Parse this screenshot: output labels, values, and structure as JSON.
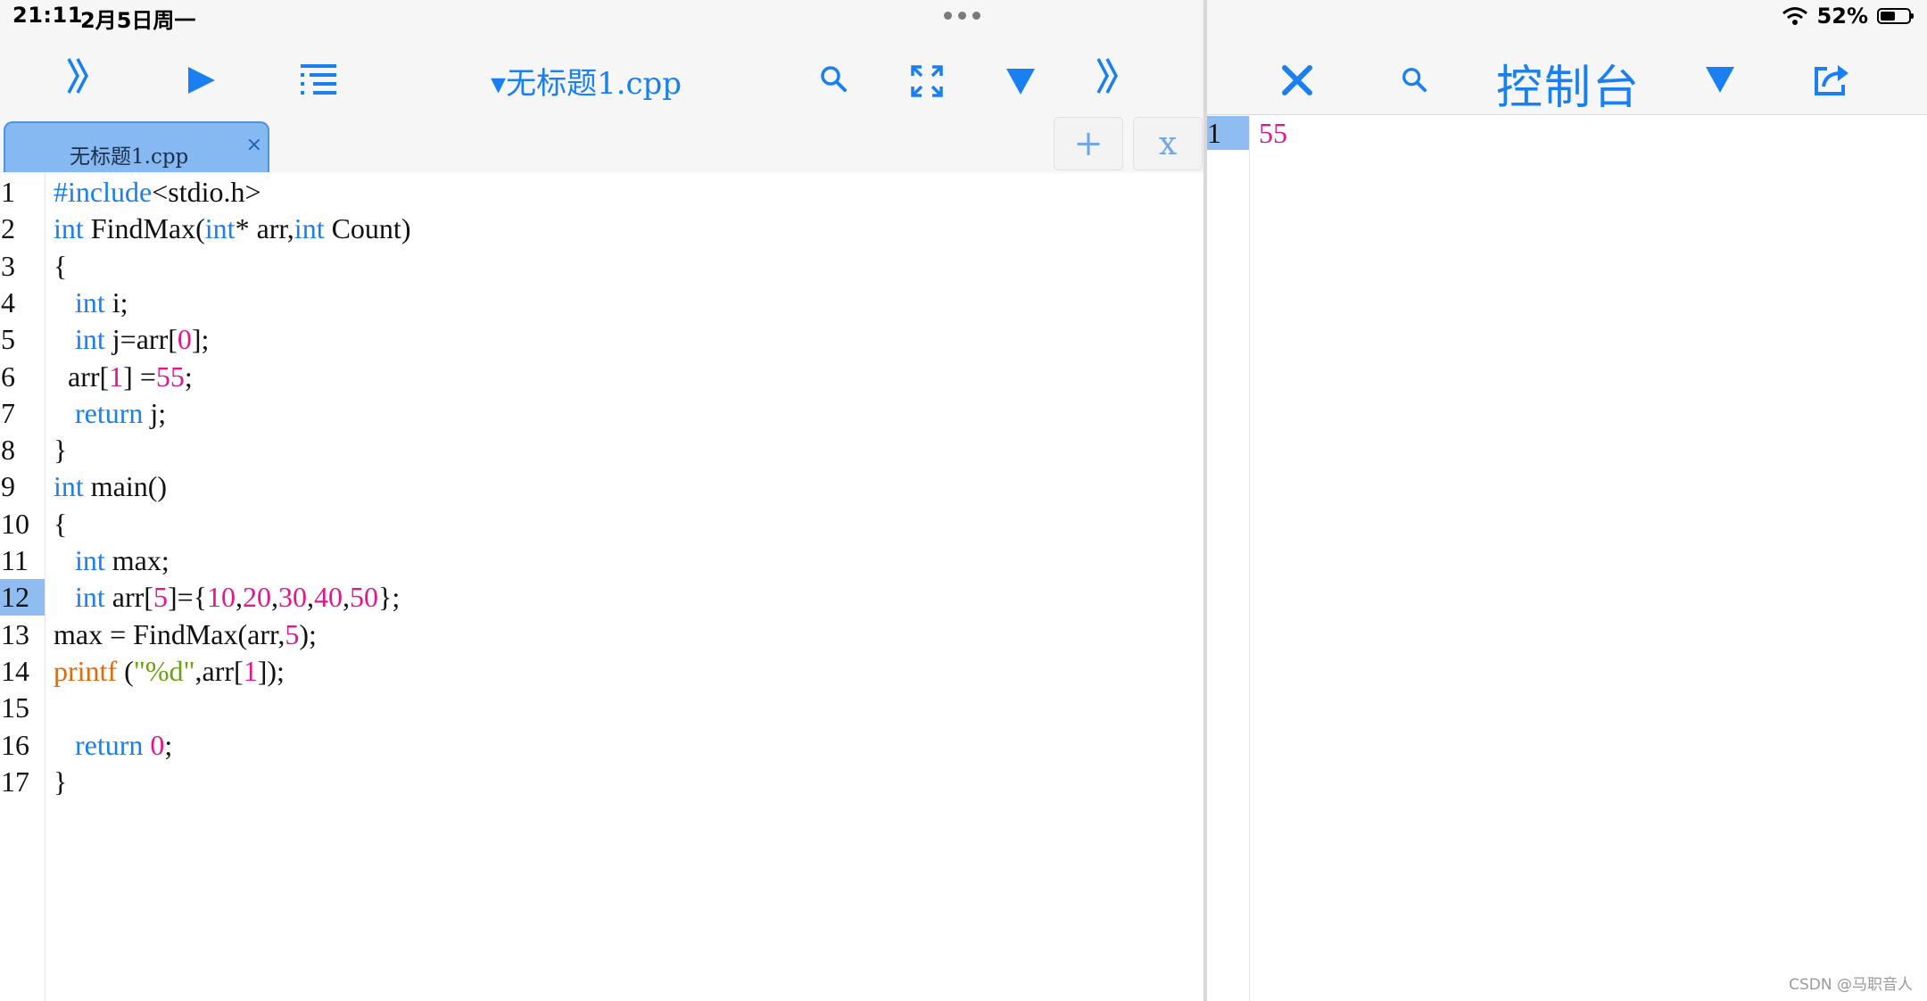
{
  "status_bar": {
    "time": "21:11",
    "date": "2月5日周一",
    "battery_percent": "52%",
    "battery_level": 0.52
  },
  "editor": {
    "toolbar": {
      "file_title": "▾无标题1.cpp",
      "icons": [
        "double-chevron-right-icon",
        "play-icon",
        "outline-list-icon",
        "search-icon",
        "expand-icon",
        "triangle-down-icon",
        "double-chevron-right-icon"
      ]
    },
    "tab": {
      "label": "无标题1.cpp",
      "close": "×"
    },
    "tab_buttons": {
      "add": "+",
      "close": "x"
    },
    "active_line": 12,
    "line_numbers": [
      "1",
      "2",
      "3",
      "4",
      "5",
      "6",
      "7",
      "8",
      "9",
      "10",
      "11",
      "12",
      "13",
      "14",
      "15",
      "16",
      "17"
    ],
    "code": [
      [
        {
          "t": "#include",
          "c": "pp"
        },
        {
          "t": "<stdio.h>",
          "c": ""
        }
      ],
      [
        {
          "t": "int",
          "c": "kw"
        },
        {
          "t": " FindMax(",
          "c": ""
        },
        {
          "t": "int",
          "c": "kw"
        },
        {
          "t": "* arr,",
          "c": ""
        },
        {
          "t": "int",
          "c": "kw"
        },
        {
          "t": " Count)",
          "c": ""
        }
      ],
      [
        {
          "t": "{",
          "c": ""
        }
      ],
      [
        {
          "t": "   ",
          "c": ""
        },
        {
          "t": "int",
          "c": "kw"
        },
        {
          "t": " i;",
          "c": ""
        }
      ],
      [
        {
          "t": "   ",
          "c": ""
        },
        {
          "t": "int",
          "c": "kw"
        },
        {
          "t": " j=arr[",
          "c": ""
        },
        {
          "t": "0",
          "c": "num"
        },
        {
          "t": "];",
          "c": ""
        }
      ],
      [
        {
          "t": "  arr[",
          "c": ""
        },
        {
          "t": "1",
          "c": "num"
        },
        {
          "t": "] =",
          "c": ""
        },
        {
          "t": "55",
          "c": "num"
        },
        {
          "t": ";",
          "c": ""
        }
      ],
      [
        {
          "t": "   ",
          "c": ""
        },
        {
          "t": "return",
          "c": "kw"
        },
        {
          "t": " j;",
          "c": ""
        }
      ],
      [
        {
          "t": "}",
          "c": ""
        }
      ],
      [
        {
          "t": "int",
          "c": "kw"
        },
        {
          "t": " main()",
          "c": ""
        }
      ],
      [
        {
          "t": "{",
          "c": ""
        }
      ],
      [
        {
          "t": "   ",
          "c": ""
        },
        {
          "t": "int",
          "c": "kw"
        },
        {
          "t": " max;",
          "c": ""
        }
      ],
      [
        {
          "t": "   ",
          "c": ""
        },
        {
          "t": "int",
          "c": "kw"
        },
        {
          "t": " arr[",
          "c": ""
        },
        {
          "t": "5",
          "c": "num"
        },
        {
          "t": "]={",
          "c": ""
        },
        {
          "t": "10",
          "c": "num"
        },
        {
          "t": ",",
          "c": ""
        },
        {
          "t": "20",
          "c": "num"
        },
        {
          "t": ",",
          "c": ""
        },
        {
          "t": "30",
          "c": "num"
        },
        {
          "t": ",",
          "c": ""
        },
        {
          "t": "40",
          "c": "num"
        },
        {
          "t": ",",
          "c": ""
        },
        {
          "t": "50",
          "c": "num"
        },
        {
          "t": "};",
          "c": ""
        }
      ],
      [
        {
          "t": "max = FindMax(arr,",
          "c": ""
        },
        {
          "t": "5",
          "c": "num"
        },
        {
          "t": ");",
          "c": ""
        }
      ],
      [
        {
          "t": "printf",
          "c": "fn"
        },
        {
          "t": " (",
          "c": ""
        },
        {
          "t": "\"%d\"",
          "c": "str"
        },
        {
          "t": ",arr[",
          "c": ""
        },
        {
          "t": "1",
          "c": "num"
        },
        {
          "t": "]);",
          "c": ""
        }
      ],
      [
        {
          "t": "",
          "c": ""
        }
      ],
      [
        {
          "t": "   ",
          "c": ""
        },
        {
          "t": "return",
          "c": "kw"
        },
        {
          "t": " ",
          "c": ""
        },
        {
          "t": "0",
          "c": "num"
        },
        {
          "t": ";",
          "c": ""
        }
      ],
      [
        {
          "t": "}",
          "c": ""
        }
      ]
    ]
  },
  "console": {
    "title": "控制台",
    "icons": [
      "close-icon",
      "search-icon",
      "triangle-down-icon",
      "share-icon"
    ],
    "output_lines": [
      {
        "num": "1",
        "text": "55"
      }
    ]
  },
  "watermark": "CSDN @马职音人",
  "colors": {
    "accent": "#1a7ff0",
    "number": "#e0188c",
    "function": "#e06a10",
    "string": "#6aa012",
    "active_line": "#8fbdf2"
  }
}
